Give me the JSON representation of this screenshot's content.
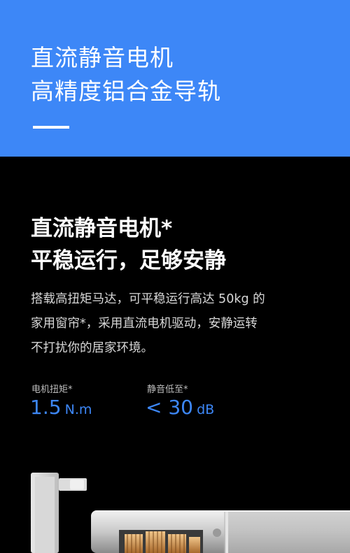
{
  "header": {
    "line1": "直流静音电机",
    "line2": "高精度铝合金导轨"
  },
  "feature": {
    "title_line1": "直流静音电机*",
    "title_line2": "平稳运行，足够安静",
    "description_line1": "搭载高扭矩马达，可平稳运行高达 50kg 的",
    "description_line2": "家用窗帘*，采用直流电机驱动，安静运转",
    "description_line3": "不打扰你的居家环境。"
  },
  "stats": [
    {
      "label": "电机扭矩*",
      "value": "1.5",
      "unit": "N.m"
    },
    {
      "label": "静音低至*",
      "value": "< 30",
      "unit": "dB"
    }
  ],
  "colors": {
    "accent": "#3d87f7",
    "background": "#000000"
  }
}
